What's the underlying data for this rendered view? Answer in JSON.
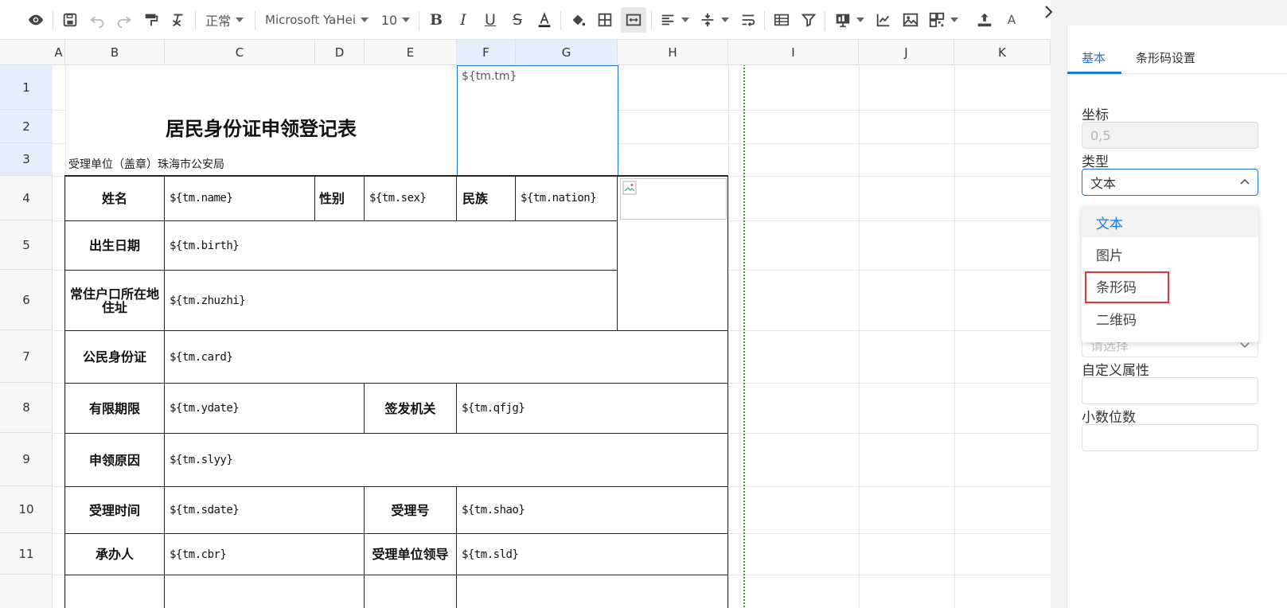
{
  "toolbar": {
    "style_value": "正常",
    "font_value": "Microsoft YaHei",
    "size_value": "10",
    "more_label": "A"
  },
  "columns": [
    "A",
    "B",
    "C",
    "D",
    "E",
    "F",
    "G",
    "H",
    "I",
    "J",
    "K"
  ],
  "rows": [
    "1",
    "2",
    "3",
    "4",
    "5",
    "6",
    "7",
    "8",
    "9",
    "10",
    "11"
  ],
  "sheet": {
    "title": "居民身份证申领登记表",
    "unit": "受理单位（盖章）珠海市公安局",
    "selected_cell_value": "${tm.tm}",
    "name_label": "姓名",
    "name_value": "${tm.name}",
    "sex_label": "性别",
    "sex_value": "${tm.sex}",
    "nation_label": "民族",
    "nation_value": "${tm.nation}",
    "birth_label": "出生日期",
    "birth_value": "${tm.birth}",
    "addr_label": "常住户口所在地住址",
    "addr_value": "${tm.zhuzhi}",
    "card_label": "公民身份证",
    "card_value": "${tm.card}",
    "ydate_label": "有限期限",
    "ydate_value": "${tm.ydate}",
    "qfjg_label": "签发机关",
    "qfjg_value": "${tm.qfjg}",
    "slyy_label": "申领原因",
    "slyy_value": "${tm.slyy}",
    "sdate_label": "受理时间",
    "sdate_value": "${tm.sdate}",
    "shao_label": "受理号",
    "shao_value": "${tm.shao}",
    "cbr_label": "承办人",
    "cbr_value": "${tm.cbr}",
    "sld_label": "受理单位领导",
    "sld_value": "${tm.sld}"
  },
  "panel": {
    "tabs": [
      "基本",
      "条形码设置"
    ],
    "coord_label": "坐标",
    "coord_value": "0,5",
    "type_label": "类型",
    "type_value": "文本",
    "type_options": [
      "文本",
      "图片",
      "条形码",
      "二维码"
    ],
    "hidden_placeholder": "请选择",
    "custom_label": "自定义属性",
    "decimal_label": "小数位数"
  },
  "colors": {
    "accent": "#1a73e8",
    "highlight": "#e53935",
    "dotted_line": "#2e9e3e"
  }
}
